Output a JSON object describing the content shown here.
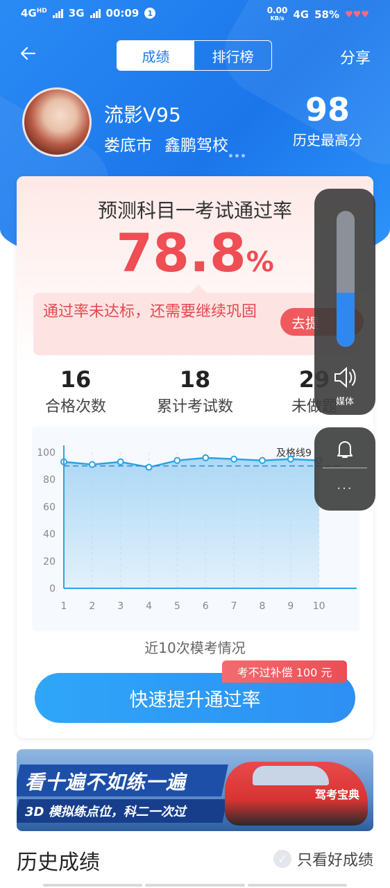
{
  "status_bar": {
    "network_left": "4G",
    "network_left_sup": "HD",
    "network_mid": "3G",
    "time": "00:09",
    "notification_count": "1",
    "speed_value": "0.00",
    "speed_unit": "KB/s",
    "network_right": "4G",
    "battery": "58%"
  },
  "nav": {
    "back_icon": "arrow-left",
    "tabs": [
      {
        "label": "成绩",
        "active": true
      },
      {
        "label": "排行榜",
        "active": false
      }
    ],
    "share_label": "分享"
  },
  "profile": {
    "name": "流影V95",
    "city": "娄底市",
    "school": "鑫鹏驾校",
    "best_score": "98",
    "best_label": "历史最高分"
  },
  "prediction": {
    "title": "预测科目一考试通过率",
    "rate_value": "78.8",
    "rate_unit": "%",
    "warning": "通过率未达标，还需要继续巩固",
    "warning_button": "去提"
  },
  "stats": [
    {
      "value": "16",
      "label": "合格次数"
    },
    {
      "value": "18",
      "label": "累计考试数"
    },
    {
      "value": "29",
      "label": "未做题"
    }
  ],
  "chart_data": {
    "type": "area",
    "title": "近10次模考情况",
    "x": [
      1,
      2,
      3,
      4,
      5,
      6,
      7,
      8,
      9,
      10
    ],
    "values": [
      93,
      91,
      93,
      89,
      94,
      96,
      95,
      94,
      95,
      94
    ],
    "ylim": [
      0,
      100
    ],
    "yticks": [
      0,
      20,
      40,
      60,
      80,
      100
    ],
    "threshold": {
      "value": 90,
      "label": "及格线9"
    },
    "grid": "vertical dashed",
    "line_color": "#2ba3e6",
    "fill_color": "#a9d6f5"
  },
  "chart_caption": "近10次模考情况",
  "cta": {
    "label": "快速提升通过率",
    "tag": "考不过补偿 100 元"
  },
  "banner": {
    "headline": "看十遍不如练一遍",
    "subline": "3D 模拟练点位，科二一次过",
    "car_text": "驾考宝典"
  },
  "history": {
    "title": "历史成绩",
    "filter_label": "只看好成绩"
  },
  "volume_panel": {
    "level": 0.4,
    "media_label": "媒体",
    "more_label": "···"
  }
}
